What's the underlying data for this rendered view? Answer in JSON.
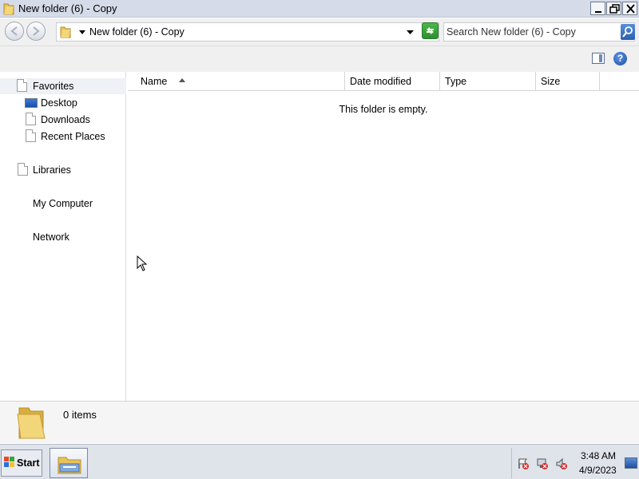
{
  "window": {
    "title": "New folder (6) - Copy"
  },
  "address_bar": {
    "path": "New folder (6) - Copy",
    "search_placeholder": "Search New folder (6) - Copy"
  },
  "nav_pane": {
    "favorites_label": "Favorites",
    "favorites_items": [
      "Desktop",
      "Downloads",
      "Recent Places"
    ],
    "libraries_label": "Libraries",
    "my_computer_label": "My Computer",
    "network_label": "Network"
  },
  "columns": {
    "name": "Name",
    "date_modified": "Date modified",
    "type": "Type",
    "size": "Size",
    "sorted_by": "Name",
    "sort_direction": "ascending"
  },
  "content": {
    "empty_message": "This folder is empty."
  },
  "details_pane": {
    "item_count": "0 items"
  },
  "taskbar": {
    "start_label": "Start",
    "time": "3:48 AM",
    "date": "4/9/2023"
  },
  "icons": {
    "folder": "folder-icon",
    "back": "back-arrow-icon",
    "forward": "forward-arrow-icon",
    "refresh": "refresh-icon",
    "search": "search-icon",
    "help": "help-icon",
    "preview_pane": "preview-pane-icon"
  },
  "colors": {
    "titlebar_bg": "#d6dbe9",
    "folder_yellow": "#e9c25a",
    "refresh_green": "#3aa53a",
    "search_blue": "#2b5fb3"
  }
}
